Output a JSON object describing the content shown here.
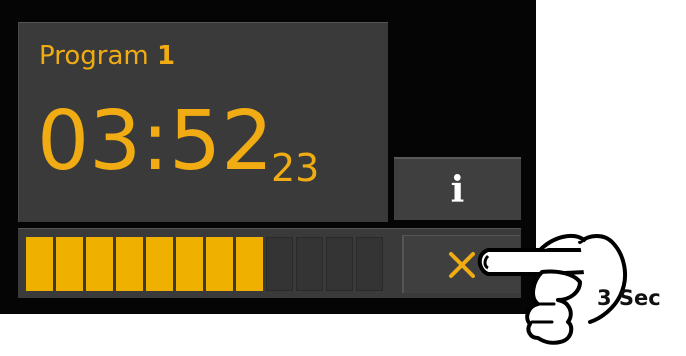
{
  "program": {
    "label": "Program",
    "number": "1"
  },
  "timer": {
    "main": "03:52",
    "sub": "23"
  },
  "info_button": {
    "label": "i"
  },
  "progress": {
    "total_segments": 12,
    "filled_segments": 8,
    "fraction": 0.667
  },
  "cancel_button": {
    "icon": "close-icon"
  },
  "instruction": {
    "icon": "pointing-hand-icon",
    "label": "3 Sec"
  },
  "colors": {
    "accent": "#f0ac12",
    "panel": "#3a3a3a",
    "device_background": "#050505",
    "segment_empty": "#343434"
  }
}
